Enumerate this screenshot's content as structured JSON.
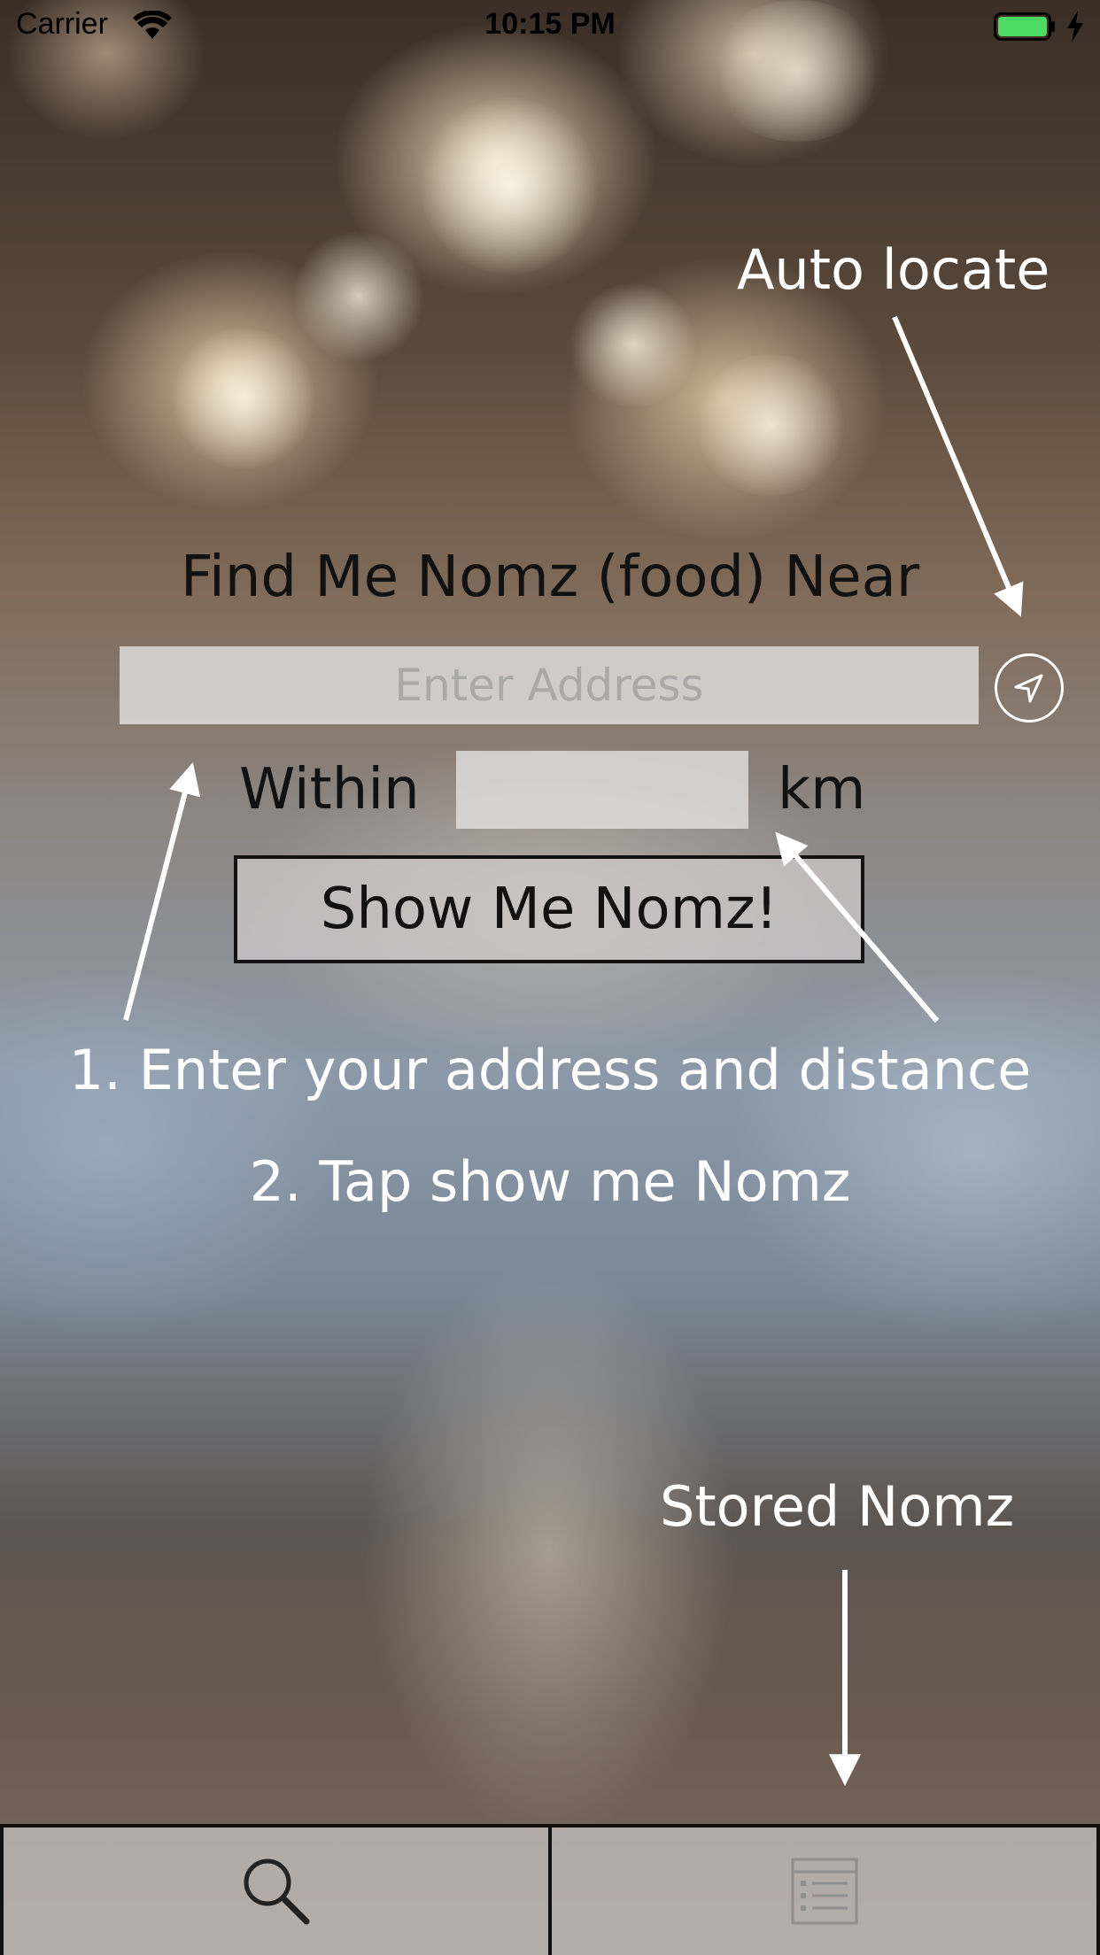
{
  "status_bar": {
    "carrier": "Carrier",
    "time": "10:15 PM",
    "battery_color": "#4cd964"
  },
  "main": {
    "headline": "Find Me Nomz (food) Near",
    "address_placeholder": "Enter Address",
    "address_value": "",
    "locate_icon": "location-arrow-icon",
    "within_label": "Within",
    "distance_value": "",
    "unit_label": "km",
    "show_button_label": "Show Me Nomz!"
  },
  "annotations": {
    "auto_locate": "Auto locate",
    "step1": "1. Enter your address and distance",
    "step2": "2. Tap show me Nomz",
    "stored": "Stored Nomz"
  },
  "tab_bar": {
    "tabs": [
      {
        "icon": "search-icon",
        "selected": true
      },
      {
        "icon": "list-icon",
        "selected": false
      }
    ]
  },
  "colors": {
    "annotation_text": "#ffffff",
    "primary_text": "#111111",
    "field_background": "#e4e4e4"
  }
}
